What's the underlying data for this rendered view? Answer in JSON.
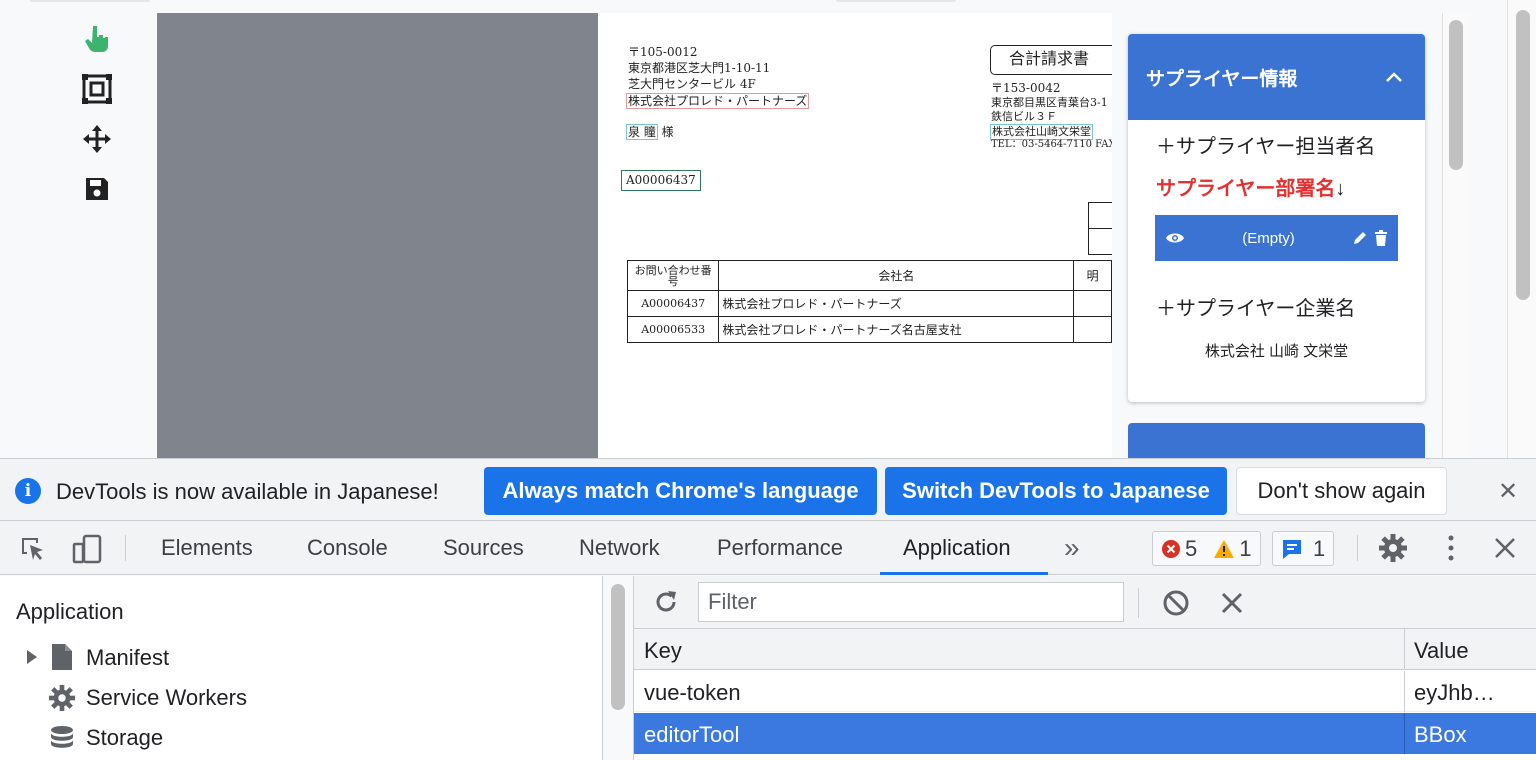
{
  "app": {
    "document": {
      "postal_left": "〒105-0012",
      "address_left_1": "東京都港区芝大門1-10-11",
      "address_left_2": "芝大門センタービル 4F",
      "company_left": "株式会社プロレド・パートナーズ",
      "contact_name": "泉 瞳",
      "honorific": "様",
      "inquiry_code": "A00006437",
      "title": "合計請求書",
      "postal_right": "〒153-0042",
      "address_right_1": "東京都目黒区青葉台3-1",
      "address_right_2": "鉄信ビル３Ｆ",
      "company_right": "株式会社山崎文栄堂",
      "tel": "TEL：03-5464-7110 FAX",
      "table": {
        "header_inquiry": "お問い合わせ番号",
        "header_company": "会社名",
        "header_extra": "明",
        "rows": [
          {
            "code": "A00006437",
            "company": "株式会社プロレド・パートナーズ"
          },
          {
            "code": "A00006533",
            "company": "株式会社プロレド・パートナーズ名古屋支社"
          }
        ]
      }
    },
    "panel": {
      "section_title": "サプライヤー情報",
      "contact_name_label": "＋サプライヤー担当者名",
      "department_label": "サプライヤー部署名",
      "department_arrow": "↓",
      "empty_value": "(Empty)",
      "company_label": "＋サプライヤー企業名",
      "company_value": "株式会社 山崎 文栄堂"
    },
    "colors": {
      "accent": "#3a73d1",
      "required_red": "#e53030",
      "cursor_green": "#3cb46e"
    }
  },
  "devtools": {
    "infobar": {
      "message": "DevTools is now available in Japanese!",
      "btn_match": "Always match Chrome's language",
      "btn_switch": "Switch DevTools to Japanese",
      "btn_dont_show": "Don't show again"
    },
    "tabs": [
      "Elements",
      "Console",
      "Sources",
      "Network",
      "Performance",
      "Application"
    ],
    "active_tab": "Application",
    "more_tabs": "»",
    "errors": "5",
    "warnings": "1",
    "messages": "1",
    "sidebar": {
      "title": "Application",
      "items": [
        "Manifest",
        "Service Workers",
        "Storage"
      ]
    },
    "storage_table": {
      "filter_placeholder": "Filter",
      "headers": {
        "key": "Key",
        "value": "Value"
      },
      "rows": [
        {
          "key": "vue-token",
          "value": "eyJhb…"
        },
        {
          "key": "editorTool",
          "value": "BBox"
        }
      ],
      "selected_row": 1
    }
  }
}
